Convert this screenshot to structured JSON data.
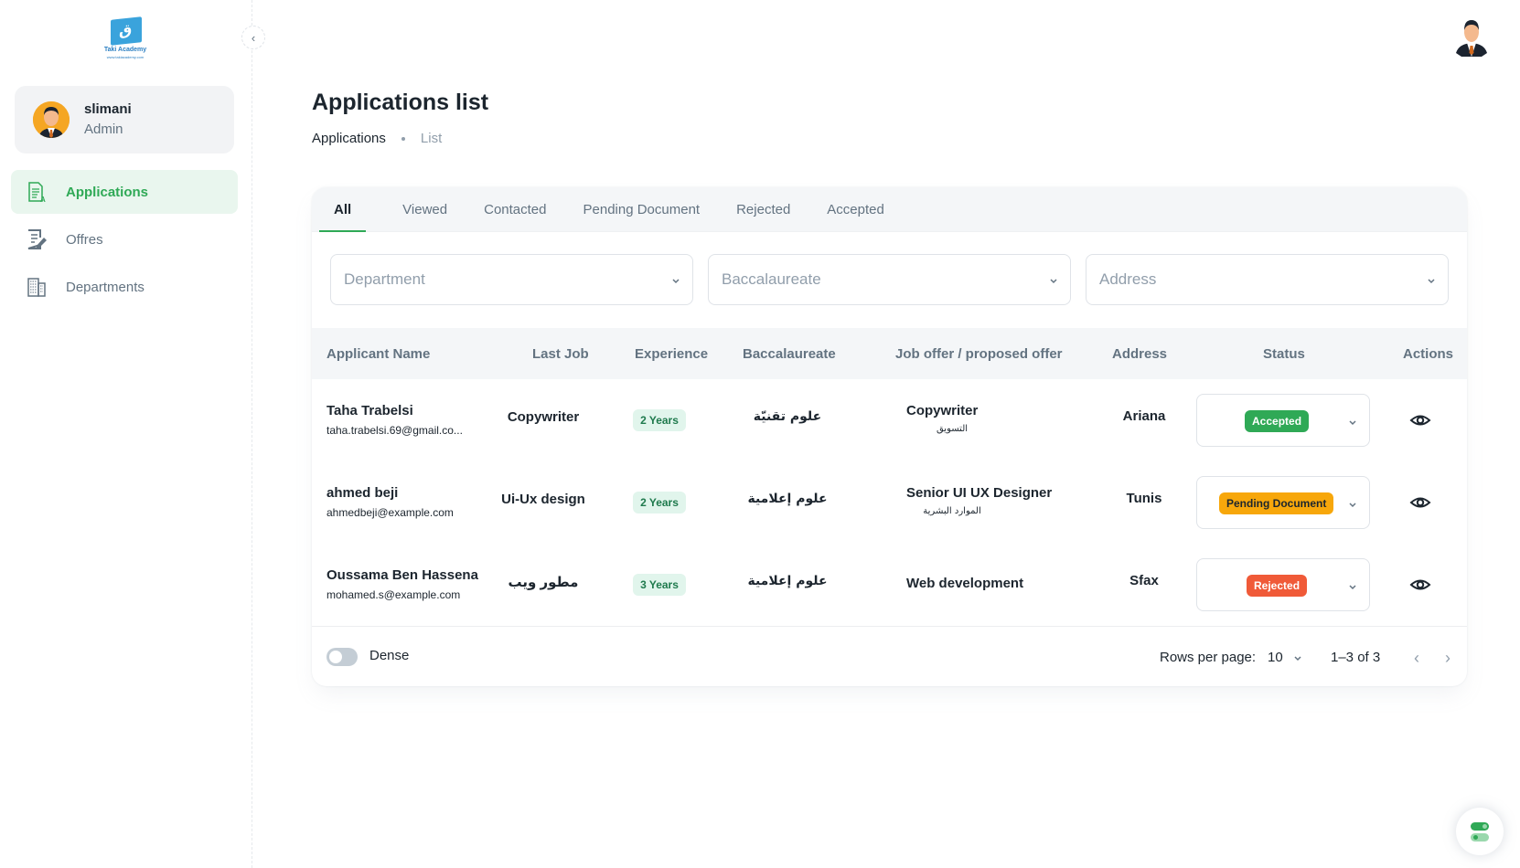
{
  "brand": {
    "name": "Taki Academy",
    "url": "www.takiacademy.com",
    "accent": "#2fa956",
    "logo_color": "#3aa3dc"
  },
  "user": {
    "name": "slimani",
    "role": "Admin"
  },
  "sidebar": {
    "items": [
      {
        "label": "Applications",
        "icon": "applications-doc-icon",
        "active": true
      },
      {
        "label": "Offres",
        "icon": "offers-edit-icon",
        "active": false
      },
      {
        "label": "Departments",
        "icon": "building-icon",
        "active": false
      }
    ]
  },
  "header": {
    "title": "Applications list",
    "breadcrumb": [
      "Applications",
      "List"
    ]
  },
  "tabs": [
    {
      "label": "All",
      "active": true
    },
    {
      "label": "Viewed",
      "active": false
    },
    {
      "label": "Contacted",
      "active": false
    },
    {
      "label": "Pending Document",
      "active": false
    },
    {
      "label": "Rejected",
      "active": false
    },
    {
      "label": "Accepted",
      "active": false
    }
  ],
  "filters": [
    {
      "placeholder": "Department"
    },
    {
      "placeholder": "Baccalaureate"
    },
    {
      "placeholder": "Address"
    }
  ],
  "table": {
    "columns": [
      "Applicant Name",
      "Last Job",
      "Experience",
      "Baccalaureate",
      "Job offer / proposed offer",
      "Address",
      "Status",
      "Actions"
    ],
    "rows": [
      {
        "name": "Taha Trabelsi",
        "email": "taha.trabelsi.69@gmail.co...",
        "last_job": "Copywriter",
        "experience": "2 Years",
        "baccalaureate": "علوم تقنيّة",
        "offer": "Copywriter",
        "offer_dept": "التسويق",
        "address": "Ariana",
        "status": "Accepted",
        "status_color": "#2fa956",
        "status_text_color": "#ffffff"
      },
      {
        "name": "ahmed beji",
        "email": "ahmedbeji@example.com",
        "last_job": "Ui-Ux design",
        "experience": "2 Years",
        "baccalaureate": "علوم إعلامية",
        "offer": "Senior UI UX Designer",
        "offer_dept": "الموارد البشرية",
        "address": "Tunis",
        "status": "Pending Document",
        "status_color": "#f7a70b",
        "status_text_color": "#1c252e"
      },
      {
        "name": "Oussama Ben Hassena",
        "email": "mohamed.s@example.com",
        "last_job": "مطور ويب",
        "experience": "3 Years",
        "baccalaureate": "علوم إعلامية",
        "offer": "Web development",
        "offer_dept": "",
        "address": "Sfax",
        "status": "Rejected",
        "status_color": "#f05a38",
        "status_text_color": "#ffffff"
      }
    ]
  },
  "footer": {
    "dense_label": "Dense",
    "dense_on": false,
    "rows_per_page_label": "Rows per page:",
    "rows_per_page": "10",
    "range": "1–3 of 3"
  }
}
